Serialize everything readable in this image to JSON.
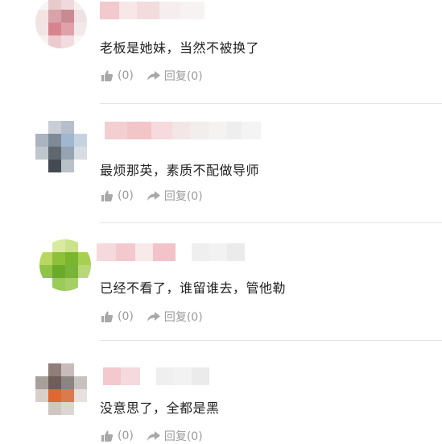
{
  "colors": {
    "text": "#222222",
    "meta": "#9a9a9a",
    "divider": "#e4e4e4"
  },
  "comments": [
    {
      "text": "老板是她妹，当然不被换了",
      "like_label": "(0)",
      "reply_label": "回复(0)",
      "avatar_tone": "pink"
    },
    {
      "text": "最烦那英，素质不配做导师",
      "like_label": "(0)",
      "reply_label": "回复(0)",
      "avatar_tone": "blue-gray"
    },
    {
      "text": "已经不看了，谁留谁去，管他勒",
      "like_label": "(0)",
      "reply_label": "回复(0)",
      "avatar_tone": "green"
    },
    {
      "text": "没意思了，全都是黑",
      "like_label": "(0)",
      "reply_label": "回复(0)",
      "avatar_tone": "orange-gray"
    }
  ],
  "icons": {
    "like": "thumbs-up-icon",
    "reply": "share-arrow-icon"
  }
}
